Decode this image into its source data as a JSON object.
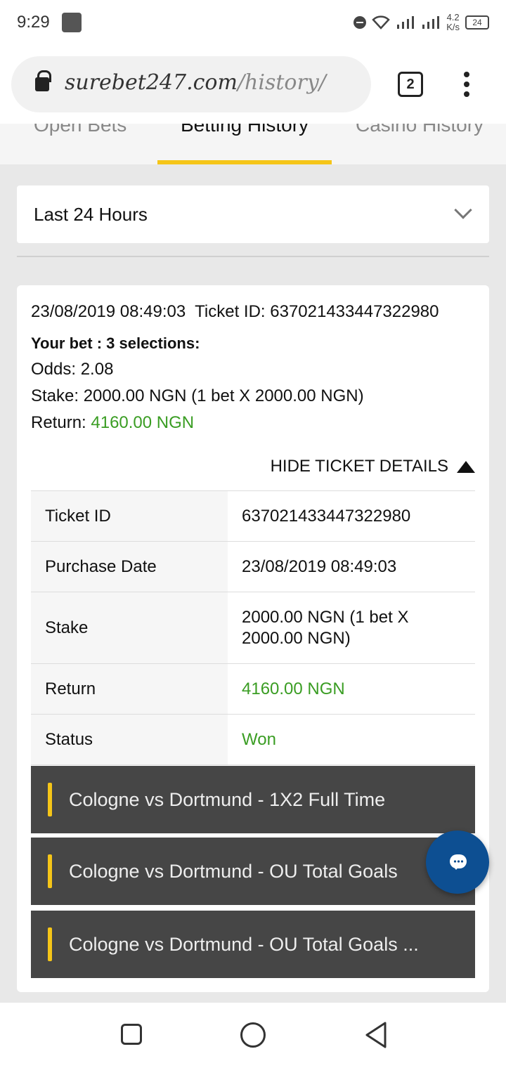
{
  "status_bar": {
    "time": "9:29",
    "network_speed_value": "4.2",
    "network_speed_unit": "K/s",
    "battery": "24"
  },
  "browser": {
    "url_domain": "surebet247.com",
    "url_path": "/history/",
    "tab_count": "2"
  },
  "tabs": [
    {
      "label": "Open Bets",
      "active": false
    },
    {
      "label": "Betting History",
      "active": true
    },
    {
      "label": "Casino History",
      "active": false
    }
  ],
  "filter": {
    "selected_period": "Last 24 Hours"
  },
  "ticket": {
    "date_time": "23/08/2019 08:49:03",
    "ticket_id_line": "Ticket ID: 637021433447322980",
    "your_bet": "Your bet : 3 selections:",
    "odds": "Odds: 2.08",
    "stake": "Stake: 2000.00 NGN (1 bet X 2000.00 NGN)",
    "return_label": "Return: ",
    "return_value": "4160.00 NGN",
    "hide_details_label": "HIDE TICKET DETAILS",
    "details": [
      {
        "label": "Ticket ID",
        "value": "637021433447322980"
      },
      {
        "label": "Purchase Date",
        "value": "23/08/2019 08:49:03"
      },
      {
        "label": "Stake",
        "value": "2000.00 NGN (1 bet X 2000.00 NGN)"
      },
      {
        "label": "Return",
        "value": "4160.00 NGN"
      },
      {
        "label": "Status",
        "value": "Won"
      }
    ],
    "selections": [
      "Cologne vs Dortmund - 1X2 Full Time",
      "Cologne vs Dortmund - OU Total Goals",
      "Cologne vs Dortmund - OU Total Goals ..."
    ]
  },
  "colors": {
    "accent_yellow": "#f5c518",
    "positive_green": "#3a9d23",
    "selection_bar_bg": "#464646",
    "chat_button_blue": "#0d4f92"
  }
}
